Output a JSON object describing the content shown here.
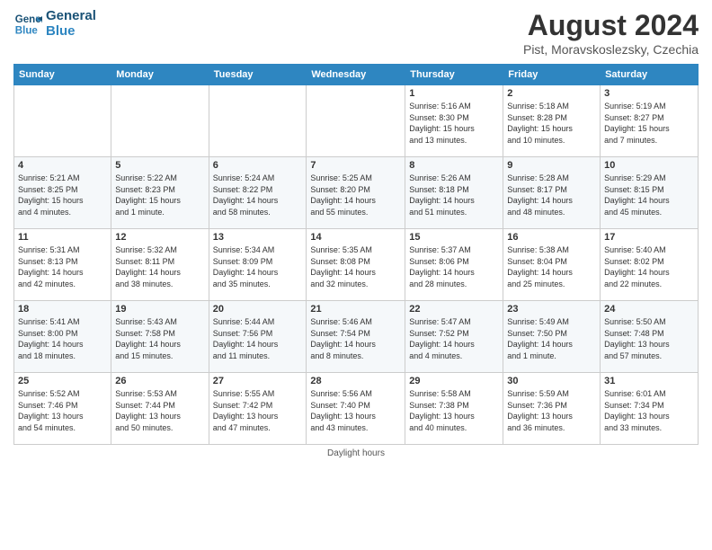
{
  "header": {
    "logo_line1": "General",
    "logo_line2": "Blue",
    "title": "August 2024",
    "subtitle": "Pist, Moravskoslezsky, Czechia"
  },
  "weekdays": [
    "Sunday",
    "Monday",
    "Tuesday",
    "Wednesday",
    "Thursday",
    "Friday",
    "Saturday"
  ],
  "footer": "Daylight hours",
  "weeks": [
    [
      {
        "day": "",
        "info": ""
      },
      {
        "day": "",
        "info": ""
      },
      {
        "day": "",
        "info": ""
      },
      {
        "day": "",
        "info": ""
      },
      {
        "day": "1",
        "info": "Sunrise: 5:16 AM\nSunset: 8:30 PM\nDaylight: 15 hours\nand 13 minutes."
      },
      {
        "day": "2",
        "info": "Sunrise: 5:18 AM\nSunset: 8:28 PM\nDaylight: 15 hours\nand 10 minutes."
      },
      {
        "day": "3",
        "info": "Sunrise: 5:19 AM\nSunset: 8:27 PM\nDaylight: 15 hours\nand 7 minutes."
      }
    ],
    [
      {
        "day": "4",
        "info": "Sunrise: 5:21 AM\nSunset: 8:25 PM\nDaylight: 15 hours\nand 4 minutes."
      },
      {
        "day": "5",
        "info": "Sunrise: 5:22 AM\nSunset: 8:23 PM\nDaylight: 15 hours\nand 1 minute."
      },
      {
        "day": "6",
        "info": "Sunrise: 5:24 AM\nSunset: 8:22 PM\nDaylight: 14 hours\nand 58 minutes."
      },
      {
        "day": "7",
        "info": "Sunrise: 5:25 AM\nSunset: 8:20 PM\nDaylight: 14 hours\nand 55 minutes."
      },
      {
        "day": "8",
        "info": "Sunrise: 5:26 AM\nSunset: 8:18 PM\nDaylight: 14 hours\nand 51 minutes."
      },
      {
        "day": "9",
        "info": "Sunrise: 5:28 AM\nSunset: 8:17 PM\nDaylight: 14 hours\nand 48 minutes."
      },
      {
        "day": "10",
        "info": "Sunrise: 5:29 AM\nSunset: 8:15 PM\nDaylight: 14 hours\nand 45 minutes."
      }
    ],
    [
      {
        "day": "11",
        "info": "Sunrise: 5:31 AM\nSunset: 8:13 PM\nDaylight: 14 hours\nand 42 minutes."
      },
      {
        "day": "12",
        "info": "Sunrise: 5:32 AM\nSunset: 8:11 PM\nDaylight: 14 hours\nand 38 minutes."
      },
      {
        "day": "13",
        "info": "Sunrise: 5:34 AM\nSunset: 8:09 PM\nDaylight: 14 hours\nand 35 minutes."
      },
      {
        "day": "14",
        "info": "Sunrise: 5:35 AM\nSunset: 8:08 PM\nDaylight: 14 hours\nand 32 minutes."
      },
      {
        "day": "15",
        "info": "Sunrise: 5:37 AM\nSunset: 8:06 PM\nDaylight: 14 hours\nand 28 minutes."
      },
      {
        "day": "16",
        "info": "Sunrise: 5:38 AM\nSunset: 8:04 PM\nDaylight: 14 hours\nand 25 minutes."
      },
      {
        "day": "17",
        "info": "Sunrise: 5:40 AM\nSunset: 8:02 PM\nDaylight: 14 hours\nand 22 minutes."
      }
    ],
    [
      {
        "day": "18",
        "info": "Sunrise: 5:41 AM\nSunset: 8:00 PM\nDaylight: 14 hours\nand 18 minutes."
      },
      {
        "day": "19",
        "info": "Sunrise: 5:43 AM\nSunset: 7:58 PM\nDaylight: 14 hours\nand 15 minutes."
      },
      {
        "day": "20",
        "info": "Sunrise: 5:44 AM\nSunset: 7:56 PM\nDaylight: 14 hours\nand 11 minutes."
      },
      {
        "day": "21",
        "info": "Sunrise: 5:46 AM\nSunset: 7:54 PM\nDaylight: 14 hours\nand 8 minutes."
      },
      {
        "day": "22",
        "info": "Sunrise: 5:47 AM\nSunset: 7:52 PM\nDaylight: 14 hours\nand 4 minutes."
      },
      {
        "day": "23",
        "info": "Sunrise: 5:49 AM\nSunset: 7:50 PM\nDaylight: 14 hours\nand 1 minute."
      },
      {
        "day": "24",
        "info": "Sunrise: 5:50 AM\nSunset: 7:48 PM\nDaylight: 13 hours\nand 57 minutes."
      }
    ],
    [
      {
        "day": "25",
        "info": "Sunrise: 5:52 AM\nSunset: 7:46 PM\nDaylight: 13 hours\nand 54 minutes."
      },
      {
        "day": "26",
        "info": "Sunrise: 5:53 AM\nSunset: 7:44 PM\nDaylight: 13 hours\nand 50 minutes."
      },
      {
        "day": "27",
        "info": "Sunrise: 5:55 AM\nSunset: 7:42 PM\nDaylight: 13 hours\nand 47 minutes."
      },
      {
        "day": "28",
        "info": "Sunrise: 5:56 AM\nSunset: 7:40 PM\nDaylight: 13 hours\nand 43 minutes."
      },
      {
        "day": "29",
        "info": "Sunrise: 5:58 AM\nSunset: 7:38 PM\nDaylight: 13 hours\nand 40 minutes."
      },
      {
        "day": "30",
        "info": "Sunrise: 5:59 AM\nSunset: 7:36 PM\nDaylight: 13 hours\nand 36 minutes."
      },
      {
        "day": "31",
        "info": "Sunrise: 6:01 AM\nSunset: 7:34 PM\nDaylight: 13 hours\nand 33 minutes."
      }
    ]
  ]
}
